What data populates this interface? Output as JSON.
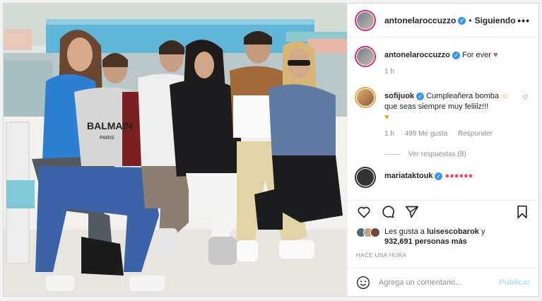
{
  "header": {
    "username": "antonelaroccuzzo",
    "dot": "•",
    "follow_label": "Siguiendo",
    "more": "•••"
  },
  "caption": {
    "username": "antonelaroccuzzo",
    "text": "For ever",
    "emoji": "♥",
    "time": "1 h"
  },
  "comment": {
    "username": "sofijuok",
    "text": "Cumpleañera bomba",
    "text2": "que seas siempre muy feliiiz!!!",
    "emoji1": "☺",
    "emoji2": "♥",
    "time": "1 h",
    "likes": "499 Me gusta",
    "reply": "Responder",
    "view_replies": "Ver respuestas (8)"
  },
  "next_comment": {
    "username": "mariataktouk",
    "emojis": "●●●●●●"
  },
  "likes": {
    "prefix": "Les gusta a",
    "user": "luisescobarok",
    "conj": "y",
    "count": "932,691 personas más"
  },
  "timestamp": "HACE UNA HORA",
  "add_comment": {
    "placeholder": "Agrega un comentario...",
    "publish": "Publicar"
  },
  "photo": {
    "shirt_text_1": "BALMAIN",
    "shirt_text_2": "PARIS"
  },
  "colors": {
    "verified": "#3897f0",
    "ring": "#d62976",
    "publish": "#b2dffc",
    "heart": "#ed4956"
  }
}
